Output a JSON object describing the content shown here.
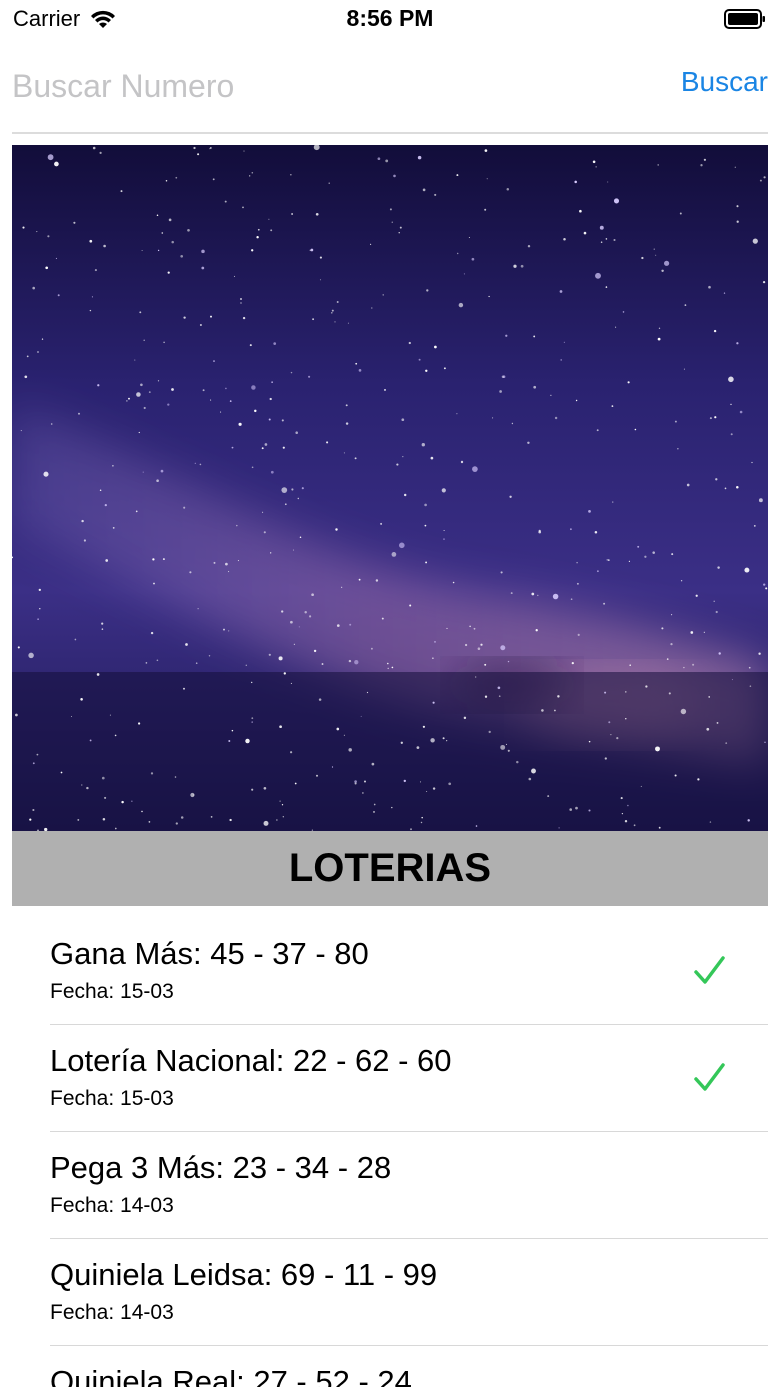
{
  "status_bar": {
    "carrier": "Carrier",
    "time": "8:56 PM"
  },
  "search": {
    "placeholder": "Buscar Numero",
    "button_label": "Buscar",
    "accent_color": "#1a85e4"
  },
  "banner": {
    "icon": "starry-sky-image"
  },
  "section": {
    "title": "LOTERIAS"
  },
  "results": [
    {
      "title": "Gana Más: 45 - 37 - 80",
      "date": "Fecha: 15-03",
      "checked": true
    },
    {
      "title": "Lotería Nacional: 22 - 62 - 60",
      "date": "Fecha: 15-03",
      "checked": true
    },
    {
      "title": "Pega 3 Más: 23 - 34 - 28",
      "date": "Fecha: 14-03",
      "checked": false
    },
    {
      "title": "Quiniela Leidsa: 69 - 11 - 99",
      "date": "Fecha: 14-03",
      "checked": false
    },
    {
      "title": "Quiniela Real: 27 - 52 - 24",
      "date": "",
      "checked": false
    }
  ],
  "check_color": "#34c759"
}
